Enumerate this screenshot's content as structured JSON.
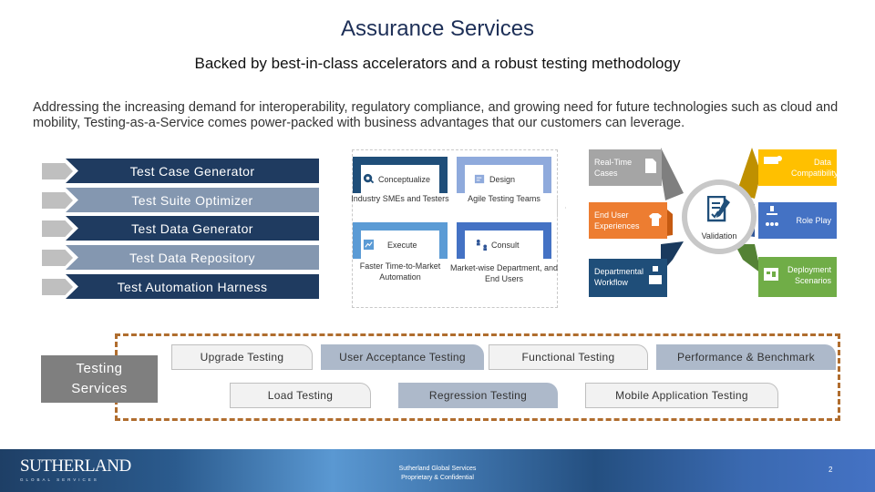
{
  "header": {
    "title": "Assurance Services",
    "subtitle": "Backed by best-in-class accelerators and a robust testing methodology",
    "intro": "Addressing the increasing demand for interoperability, regulatory compliance, and growing need for future technologies such as cloud and mobility, Testing-as-a-Service comes power-packed with business advantages that our customers can leverage."
  },
  "accelerators": [
    {
      "label": "Test Case Generator",
      "style": "dark"
    },
    {
      "label": "Test Suite Optimizer",
      "style": "light"
    },
    {
      "label": "Test Data Generator",
      "style": "dark"
    },
    {
      "label": "Test Data Repository",
      "style": "light"
    },
    {
      "label": "Test Automation Harness",
      "style": "dark"
    }
  ],
  "methodology": [
    {
      "phase": "Conceptualize",
      "description": "Industry SMEs and Testers",
      "icon": "gear-search-icon",
      "color": "#1f4e79"
    },
    {
      "phase": "Design",
      "description": "Agile Testing Teams",
      "icon": "document-pen-icon",
      "color": "#8faadc"
    },
    {
      "phase": "Execute",
      "description": "Faster Time-to-Market Automation",
      "icon": "chart-board-icon",
      "color": "#5b9bd5"
    },
    {
      "phase": "Consult",
      "description": "Market-wise Department, and End Users",
      "icon": "people-exchange-icon",
      "color": "#4472c4"
    }
  ],
  "validation": {
    "center_label": "Validation",
    "center_icon": "checklist-pen-icon",
    "spokes": [
      {
        "label": "Real-Time Cases",
        "icon": "document-icon",
        "color": "#a5a5a5"
      },
      {
        "label": "Data Compatibility",
        "icon": "puzzle-icon",
        "color": "#ffc000"
      },
      {
        "label": "End User Experiences",
        "icon": "shirt-icon",
        "color": "#ed7d31"
      },
      {
        "label": "Role Play",
        "icon": "hierarchy-icon",
        "color": "#4472c4"
      },
      {
        "label": "Departmental Workflow",
        "icon": "org-chart-icon",
        "color": "#1f4e79"
      },
      {
        "label": "Deployment Scenarios",
        "icon": "board-icon",
        "color": "#70ad47"
      }
    ]
  },
  "testing_services": {
    "label": "Testing Services",
    "row1": [
      {
        "label": "Upgrade Testing",
        "style": "light"
      },
      {
        "label": "User Acceptance Testing",
        "style": "dark"
      },
      {
        "label": "Functional Testing",
        "style": "light"
      },
      {
        "label": "Performance & Benchmark",
        "style": "dark"
      }
    ],
    "row2": [
      {
        "label": "Load Testing",
        "style": "light"
      },
      {
        "label": "Regression Testing",
        "style": "dark"
      },
      {
        "label": "Mobile Application Testing",
        "style": "light"
      }
    ]
  },
  "footer": {
    "logo": "SUTHERLAND",
    "logo_tagline": "GLOBAL SERVICES",
    "center_line1": "Sutherland Global Services",
    "center_line2": "Proprietary & Confidential",
    "page_number": "2"
  }
}
